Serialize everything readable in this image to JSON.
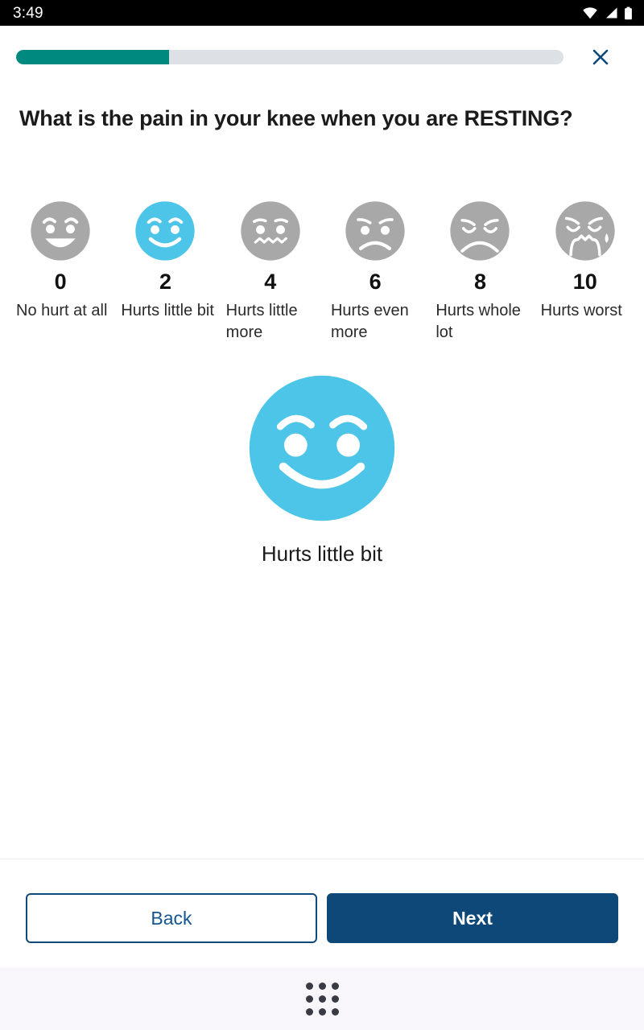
{
  "status_bar": {
    "time": "3:49",
    "icons": [
      "wifi-icon",
      "cellular-signal-icon",
      "battery-icon"
    ]
  },
  "header": {
    "progress_percent": 28,
    "progress_fill_color": "#00897f",
    "progress_track_color": "#dde1e6",
    "close_label": "✕",
    "close_icon": "close-icon",
    "close_color": "#0d4878"
  },
  "question": {
    "text": "What is the pain in your knee when you are RESTING?"
  },
  "scale": {
    "selected_value": "2",
    "selected_color": "#4cc5e8",
    "unselected_color": "#a8a8a8",
    "options": [
      {
        "value": "0",
        "label": "No hurt at all",
        "face": "grinning-face",
        "selected": false
      },
      {
        "value": "2",
        "label": "Hurts little bit",
        "face": "smiling-face",
        "selected": true
      },
      {
        "value": "4",
        "label": "Hurts little more",
        "face": "wavy-mouth-face",
        "selected": false
      },
      {
        "value": "6",
        "label": "Hurts even more",
        "face": "frowning-face",
        "selected": false
      },
      {
        "value": "8",
        "label": "Hurts whole lot",
        "face": "distressed-face",
        "selected": false
      },
      {
        "value": "10",
        "label": "Hurts worst",
        "face": "crying-face",
        "selected": false
      }
    ]
  },
  "selection_preview": {
    "face": "smiling-face",
    "label": "Hurts little bit",
    "color": "#4cc5e8"
  },
  "footer": {
    "back_label": "Back",
    "next_label": "Next",
    "back_color": "#14558f",
    "next_color": "#0d4878"
  },
  "system_nav": {
    "app_grid_icon": "app-grid-icon"
  }
}
